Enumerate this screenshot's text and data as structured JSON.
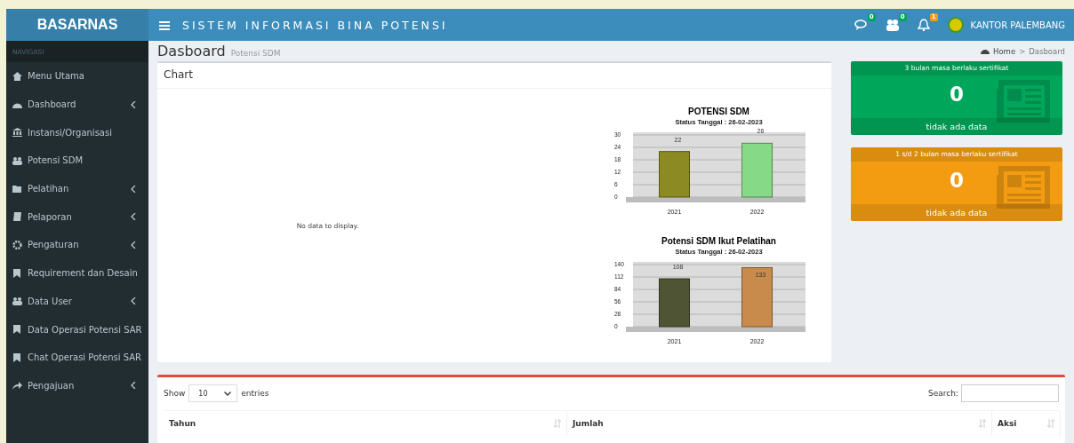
{
  "brand": "BASARNAS",
  "app_title": "SISTEM INFORMASI BINA POTENSI",
  "navbar_icons": [
    {
      "badge": "0",
      "color": "#00a65a"
    },
    {
      "badge": "0",
      "color": "#00a65a"
    },
    {
      "badge": "1",
      "color": "#f39c12"
    }
  ],
  "user": "KANTOR PALEMBANG",
  "sidebar": {
    "header": "NAVIGASI",
    "items": [
      {
        "label": "Menu Utama",
        "has_submenu": false
      },
      {
        "label": "Dashboard",
        "has_submenu": true
      },
      {
        "label": "Instansi/Organisasi",
        "has_submenu": false
      },
      {
        "label": "Potensi SDM",
        "has_submenu": false
      },
      {
        "label": "Pelatihan",
        "has_submenu": true
      },
      {
        "label": "Pelaporan",
        "has_submenu": true
      },
      {
        "label": "Pengaturan",
        "has_submenu": true
      },
      {
        "label": "Requirement dan Desain",
        "has_submenu": false
      },
      {
        "label": "Data User",
        "has_submenu": true
      },
      {
        "label": "Data Operasi Potensi SAR",
        "has_submenu": false
      },
      {
        "label": "Chat Operasi Potensi SAR",
        "has_submenu": false
      },
      {
        "label": "Pengajuan",
        "has_submenu": true
      }
    ]
  },
  "page": {
    "title": "Dasboard",
    "subtitle": "Potensi SDM"
  },
  "breadcrumb": {
    "home": "Home",
    "separator": ">",
    "current": "Dasboard"
  },
  "chart_box": {
    "title": "Chart",
    "empty_message": "No data to display.",
    "charts": [
      {
        "chart_data": {
          "type": "bar",
          "title": "POTENSI SDM",
          "subtitle": "Status Tanggal : 26-02-2023",
          "categories": [
            "2021",
            "2022"
          ],
          "ylim": [
            0,
            30
          ],
          "yticks": [
            0,
            6,
            12,
            18,
            24,
            30
          ],
          "data_labels": true,
          "grid": true,
          "series": [
            {
              "color": "#8c8a22",
              "values": [
                22,
                null
              ]
            },
            {
              "color": "#86d986",
              "values": [
                null,
                26
              ]
            }
          ]
        }
      },
      {
        "chart_data": {
          "type": "bar",
          "title": "Potensi SDM Ikut Pelatihan",
          "subtitle": "Status Tanggal : 26-02-2023",
          "categories": [
            "2021",
            "2022"
          ],
          "ylim": [
            0,
            140
          ],
          "yticks": [
            0,
            28,
            56,
            84,
            112,
            140
          ],
          "data_labels": true,
          "grid": true,
          "series": [
            {
              "color": "#4f5434",
              "values": [
                108,
                null
              ]
            },
            {
              "color": "#c98b4b",
              "values": [
                null,
                133
              ]
            }
          ]
        }
      }
    ]
  },
  "info_boxes": [
    {
      "header": "3 bulan masa berlaku sertifikat",
      "count": "0",
      "footer": "tidak ada data",
      "color": "#00a65a"
    },
    {
      "header": "1 s/d 2 bulan masa berlaku sertifikat",
      "count": "0",
      "footer": "tidak ada data",
      "color": "#f39c12"
    }
  ],
  "table_box": {
    "show_label": "Show",
    "page_size": "10",
    "entries_label": "entries",
    "search_label": "Search:",
    "columns": [
      "Tahun",
      "Jumlah",
      "Aksi"
    ]
  }
}
